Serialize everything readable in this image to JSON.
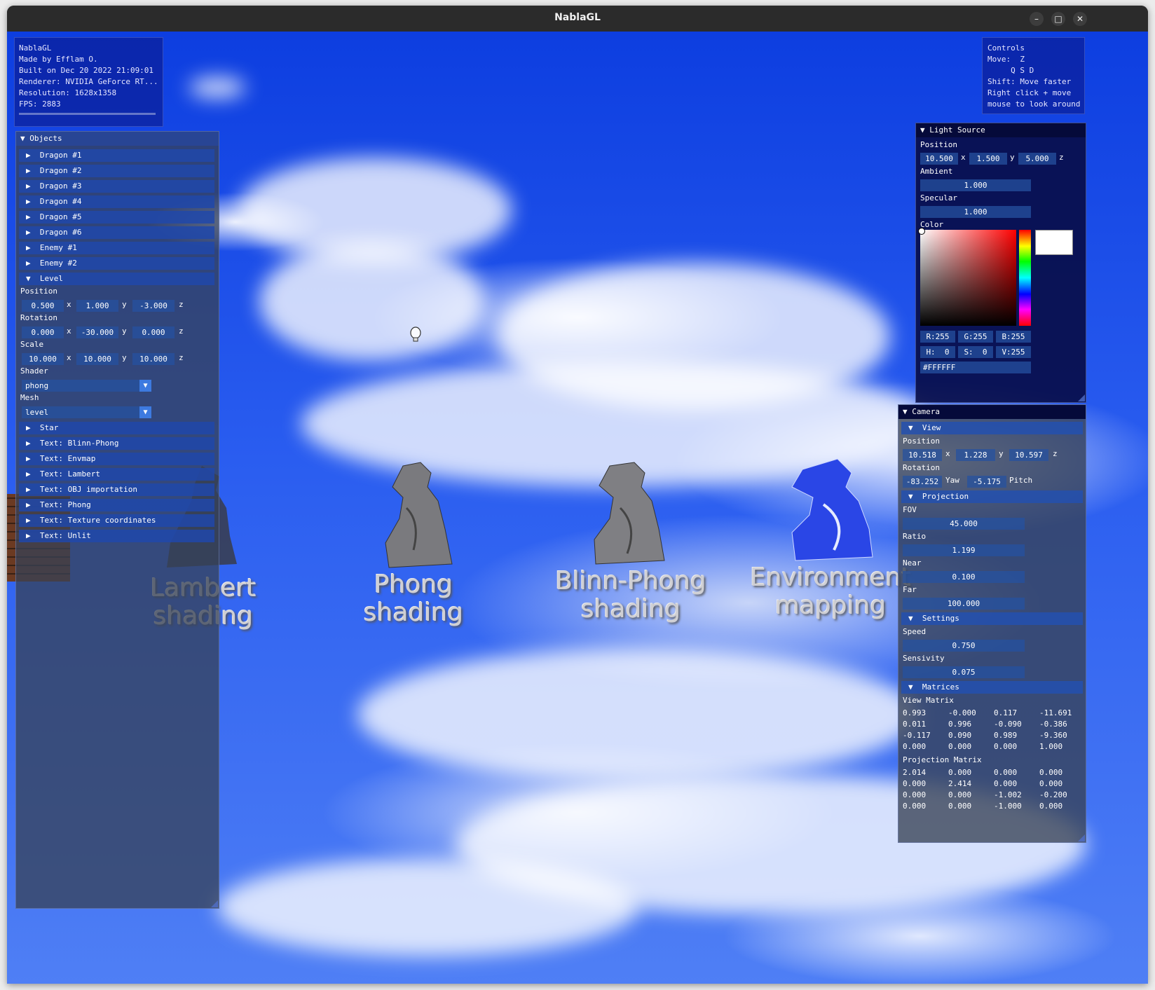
{
  "window": {
    "title": "NablaGL",
    "buttons": {
      "minimize": "–",
      "maximize": "□",
      "close": "✕"
    }
  },
  "info_overlay": {
    "lines": [
      "NablaGL",
      "Made by Efflam O.",
      "Built on Dec 20 2022 21:09:01",
      "Renderer: NVIDIA GeForce RT...",
      "Resolution: 1628x1358",
      "FPS: 2883"
    ]
  },
  "controls_overlay": {
    "lines": [
      "Controls",
      "Move:  Z",
      "     Q S D",
      "Shift: Move faster",
      "Right click + move",
      "mouse to look around"
    ]
  },
  "objects_panel": {
    "title": "Objects",
    "collapsed_items": [
      "Dragon #1",
      "Dragon #2",
      "Dragon #3",
      "Dragon #4",
      "Dragon #5",
      "Dragon #6",
      "Enemy #1",
      "Enemy #2"
    ],
    "level": {
      "label": "Level",
      "position_label": "Position",
      "position": [
        "0.500",
        "1.000",
        "-3.000"
      ],
      "rotation_label": "Rotation",
      "rotation": [
        "0.000",
        "-30.000",
        "0.000"
      ],
      "scale_label": "Scale",
      "scale": [
        "10.000",
        "10.000",
        "10.000"
      ],
      "axes": [
        "x",
        "y",
        "z"
      ],
      "shader_label": "Shader",
      "shader_value": "phong",
      "mesh_label": "Mesh",
      "mesh_value": "level"
    },
    "trailing_items": [
      "Star",
      "Text: Blinn-Phong",
      "Text: Envmap",
      "Text: Lambert",
      "Text: OBJ importation",
      "Text: Phong",
      "Text: Texture coordinates",
      "Text: Unlit"
    ]
  },
  "light_panel": {
    "title": "Light Source",
    "position_label": "Position",
    "position": [
      "10.500",
      "1.500",
      "5.000"
    ],
    "axes": [
      "x",
      "y",
      "z"
    ],
    "ambient_label": "Ambient",
    "ambient": "1.000",
    "specular_label": "Specular",
    "specular": "1.000",
    "color_label": "Color",
    "rgb": [
      "R:255",
      "G:255",
      "B:255"
    ],
    "hsv": [
      "H:  0",
      "S:  0",
      "V:255"
    ],
    "hex": "#FFFFFF",
    "color_hex": "#FFFFFF"
  },
  "camera_panel": {
    "title": "Camera",
    "view": {
      "label": "View",
      "position_label": "Position",
      "position": [
        "10.518",
        "1.228",
        "10.597"
      ],
      "axes": [
        "x",
        "y",
        "z"
      ],
      "rotation_label": "Rotation",
      "yaw": "-83.252",
      "yaw_label": "Yaw",
      "pitch": "-5.175",
      "pitch_label": "Pitch"
    },
    "projection": {
      "label": "Projection",
      "fov_label": "FOV",
      "fov": "45.000",
      "ratio_label": "Ratio",
      "ratio": "1.199",
      "near_label": "Near",
      "near": "0.100",
      "far_label": "Far",
      "far": "100.000"
    },
    "settings": {
      "label": "Settings",
      "speed_label": "Speed",
      "speed": "0.750",
      "sensivity_label": "Sensivity",
      "sensivity": "0.075"
    },
    "matrices": {
      "label": "Matrices",
      "view_label": "View Matrix",
      "view": [
        [
          "0.993",
          "-0.000",
          "0.117",
          "-11.691"
        ],
        [
          "0.011",
          "0.996",
          "-0.090",
          "-0.386"
        ],
        [
          "-0.117",
          "0.090",
          "0.989",
          "-9.360"
        ],
        [
          "0.000",
          "0.000",
          "0.000",
          "1.000"
        ]
      ],
      "projection_label": "Projection Matrix",
      "projection": [
        [
          "2.014",
          "0.000",
          "0.000",
          "0.000"
        ],
        [
          "0.000",
          "2.414",
          "0.000",
          "0.000"
        ],
        [
          "0.000",
          "0.000",
          "-1.002",
          "-0.200"
        ],
        [
          "0.000",
          "0.000",
          "-1.000",
          "0.000"
        ]
      ]
    }
  },
  "scene": {
    "labels": [
      {
        "line1": "Lambert",
        "line2": "shading"
      },
      {
        "line1": "Phong",
        "line2": "shading"
      },
      {
        "line1": "Blinn-Phong",
        "line2": "shading"
      },
      {
        "line1": "Environment",
        "line2": "mapping"
      }
    ],
    "colors": {
      "dragon_gray": "#7a7a7a",
      "dragon_envmap": "#2a46e6",
      "sky": "#2a5df0"
    }
  }
}
